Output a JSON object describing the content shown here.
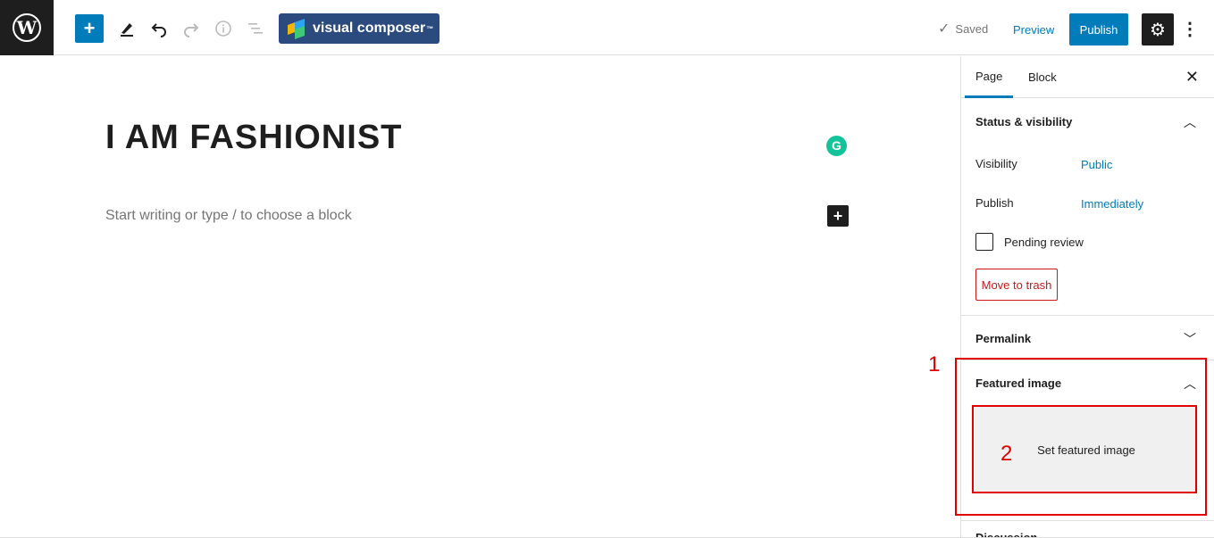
{
  "toolbar": {
    "logo_icon": "wordpress-logo-icon",
    "logo_letter": "W",
    "add_symbol": "+",
    "icons": [
      "add-block-icon",
      "pencil-icon",
      "undo-icon",
      "redo-icon",
      "info-icon",
      "list-view-icon"
    ],
    "visual_composer_label": "visual composer",
    "visual_composer_tm": "™",
    "saved_label": "Saved",
    "preview_label": "Preview",
    "publish_label": "Publish",
    "accent_color": "#007cba"
  },
  "editor": {
    "title": "I AM FASHIONIST",
    "placeholder": "Start writing or type / to choose a block",
    "grammarly_letter": "G",
    "inline_add_symbol": "+"
  },
  "sidebar": {
    "tabs": [
      {
        "label": "Page",
        "active": true
      },
      {
        "label": "Block",
        "active": false
      }
    ],
    "status_visibility": {
      "title": "Status & visibility",
      "rows": [
        {
          "label": "Visibility",
          "value": "Public"
        },
        {
          "label": "Publish",
          "value": "Immediately"
        }
      ],
      "pending_review_label": "Pending review",
      "pending_review_checked": false,
      "trash_label": "Move to trash"
    },
    "permalink_title": "Permalink",
    "featured_image": {
      "title": "Featured image",
      "button_label": "Set featured image"
    },
    "discussion_title": "Discussion"
  },
  "annotations": [
    {
      "label": "1",
      "color": "#e00000"
    },
    {
      "label": "2",
      "color": "#e00000"
    }
  ]
}
